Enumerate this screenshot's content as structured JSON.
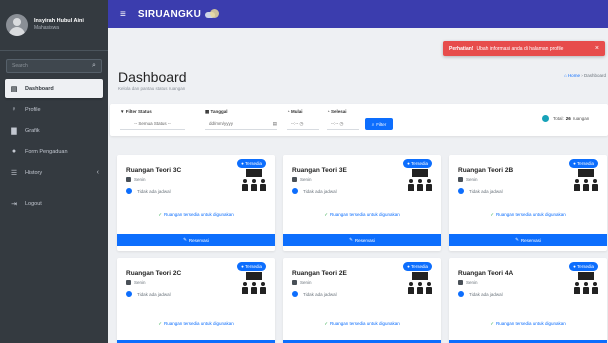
{
  "user": {
    "name": "Insyirah Hubul Aini",
    "role": "Mahasiswa"
  },
  "sidebar": {
    "search_placeholder": "Search",
    "items": [
      {
        "label": "Dashboard",
        "icon": "dashboard-icon",
        "active": true
      },
      {
        "label": "Profile",
        "icon": "user-icon"
      },
      {
        "label": "Grafik",
        "icon": "chart-icon"
      },
      {
        "label": "Form Pengaduan",
        "icon": "circle-icon"
      },
      {
        "label": "History",
        "icon": "list-icon"
      },
      {
        "label": "Logout",
        "icon": "logout-icon"
      }
    ]
  },
  "topbar": {
    "brand": "SIRUANGKU"
  },
  "alert": {
    "title": "Perhatian!",
    "message": "Ubah informasi anda di halaman profile",
    "close": "×"
  },
  "header": {
    "title": "Dashboard",
    "subtitle": "Kelola dan pantau status ruangan",
    "breadcrumb": [
      "Home",
      "Dashboard"
    ]
  },
  "filter": {
    "status_label": "Filter Status",
    "status_value": "-- Semua Status --",
    "date_label": "Tanggal",
    "date_placeholder": "dd/mm/yyyy",
    "start_label": "Mulai",
    "start_placeholder": "--:-- ◷",
    "end_label": "Selesai",
    "end_placeholder": "--:-- ◷",
    "button": "Filter",
    "total_prefix": "Total:",
    "total_count": "26",
    "total_suffix": "ruangan"
  },
  "rooms": [
    {
      "name": "Ruangan Teori 3C",
      "location": "Senin",
      "schedule": "Tidak ada jadwal",
      "badge": "Tersedia",
      "availability": "Ruangan tersedia untuk digunakan",
      "button": "Reservasi"
    },
    {
      "name": "Ruangan Teori 3E",
      "location": "Senin",
      "schedule": "Tidak ada jadwal",
      "badge": "Tersedia",
      "availability": "Ruangan tersedia untuk digunakan",
      "button": "Reservasi"
    },
    {
      "name": "Ruangan Teori 2B",
      "location": "Senin",
      "schedule": "Tidak ada jadwal",
      "badge": "Tersedia",
      "availability": "Ruangan tersedia untuk digunakan",
      "button": "Reservasi"
    },
    {
      "name": "Ruangan Teori 2C",
      "location": "Senin",
      "schedule": "Tidak ada jadwal",
      "badge": "Tersedia",
      "availability": "Ruangan tersedia untuk digunakan",
      "button": "Reservasi"
    },
    {
      "name": "Ruangan Teori 2E",
      "location": "Senin",
      "schedule": "Tidak ada jadwal",
      "badge": "Tersedia",
      "availability": "Ruangan tersedia untuk digunakan",
      "button": "Reservasi"
    },
    {
      "name": "Ruangan Teori 4A",
      "location": "Senin",
      "schedule": "Tidak ada jadwal",
      "badge": "Tersedia",
      "availability": "Ruangan tersedia untuk digunakan",
      "button": "Reservasi"
    }
  ],
  "colors": {
    "sidebar": "#343a40",
    "topbar": "#3b3dae",
    "primary": "#0d6efd",
    "alert": "#e74c4c"
  }
}
